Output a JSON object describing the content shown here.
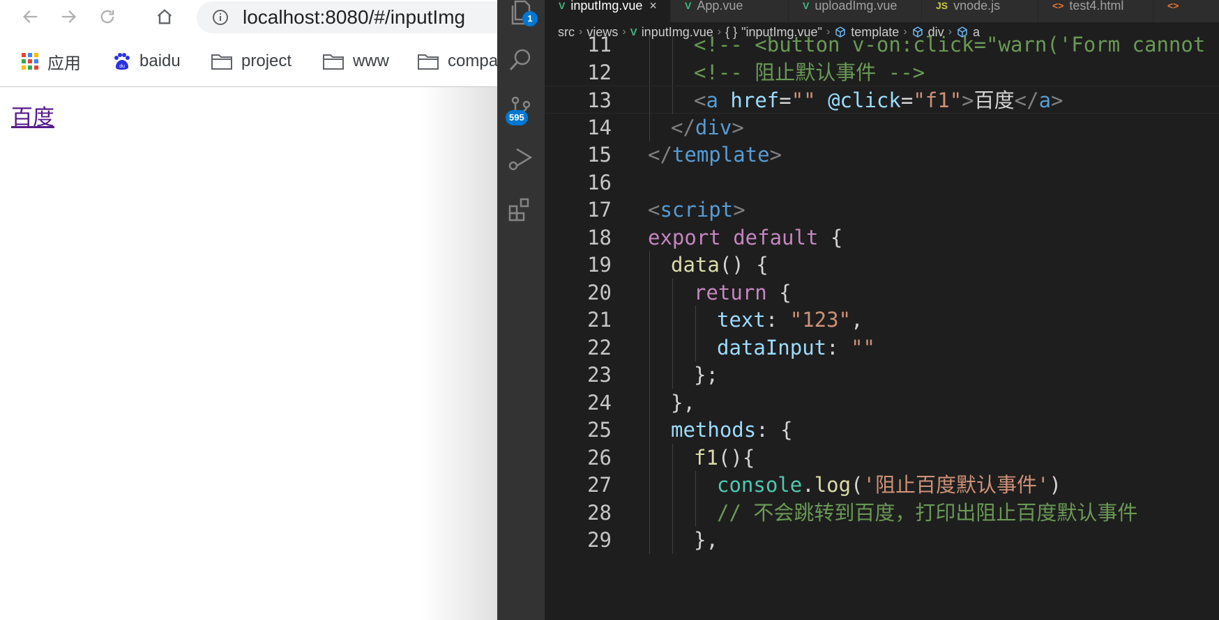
{
  "browser": {
    "url": "localhost:8080/#/inputImg",
    "bookmarks": [
      {
        "label": "应用",
        "icon": "apps-grid-icon"
      },
      {
        "label": "baidu",
        "icon": "baidu-paw-icon"
      },
      {
        "label": "project",
        "icon": "folder-icon"
      },
      {
        "label": "www",
        "icon": "folder-icon"
      },
      {
        "label": "compa",
        "icon": "folder-icon"
      }
    ],
    "page_link": "百度"
  },
  "editor": {
    "activity_badges": {
      "explorer": "1",
      "source_control": "595"
    },
    "tabs": [
      {
        "label": "inputImg.vue",
        "icon": "vue-icon",
        "close": "×"
      },
      {
        "label": "App.vue",
        "icon": "vue-icon"
      },
      {
        "label": "uploadImg.vue",
        "icon": "vue-icon"
      },
      {
        "label": "vnode.js",
        "icon": "js-icon",
        "icon_text": "JS"
      },
      {
        "label": "test4.html",
        "icon": "html-icon",
        "icon_text": "<>"
      },
      {
        "label": "",
        "icon": "html-icon",
        "icon_text": "<>"
      }
    ],
    "breadcrumb": [
      "src",
      "views",
      "inputImg.vue",
      "\"inputImg.vue\"",
      "template",
      "div",
      "a"
    ],
    "breadcrumb_symbols": [
      "",
      "",
      "",
      "{ }",
      "",
      "",
      ""
    ],
    "colors": {
      "comment": "#6a9955",
      "tag": "#569cd6",
      "keyword": "#c586c0",
      "string": "#ce9178",
      "function": "#dcdcaa",
      "property": "#9cdcfe",
      "badge": "#0078d4"
    },
    "lines": [
      {
        "n": "11",
        "indent": 2,
        "tokens": [
          {
            "t": "<!-- <button v-on:click=\"warn('Form cannot",
            "c": "comment"
          }
        ]
      },
      {
        "n": "12",
        "indent": 2,
        "tokens": [
          {
            "t": "<!-- 阻止默认事件 -->",
            "c": "comment"
          }
        ]
      },
      {
        "n": "13",
        "indent": 2,
        "tokens": [
          {
            "t": "<",
            "c": "punc"
          },
          {
            "t": "a",
            "c": "tag"
          },
          {
            "t": " ",
            "c": "plain"
          },
          {
            "t": "href",
            "c": "attr"
          },
          {
            "t": "=",
            "c": "plain"
          },
          {
            "t": "\"\"",
            "c": "str"
          },
          {
            "t": " @click",
            "c": "attr"
          },
          {
            "t": "=",
            "c": "plain"
          },
          {
            "t": "\"f1\"",
            "c": "str"
          },
          {
            "t": ">",
            "c": "punc"
          },
          {
            "t": "百度",
            "c": "plain"
          },
          {
            "t": "</",
            "c": "punc"
          },
          {
            "t": "a",
            "c": "tag"
          },
          {
            "t": ">",
            "c": "punc"
          }
        ]
      },
      {
        "n": "14",
        "indent": 1,
        "tokens": [
          {
            "t": "</",
            "c": "punc"
          },
          {
            "t": "div",
            "c": "tag"
          },
          {
            "t": ">",
            "c": "punc"
          }
        ]
      },
      {
        "n": "15",
        "indent": 0,
        "tokens": [
          {
            "t": "</",
            "c": "punc"
          },
          {
            "t": "template",
            "c": "tag"
          },
          {
            "t": ">",
            "c": "punc"
          }
        ]
      },
      {
        "n": "16",
        "indent": 0,
        "tokens": []
      },
      {
        "n": "17",
        "indent": 0,
        "tokens": [
          {
            "t": "<",
            "c": "punc"
          },
          {
            "t": "script",
            "c": "tag"
          },
          {
            "t": ">",
            "c": "punc"
          }
        ]
      },
      {
        "n": "18",
        "indent": 0,
        "tokens": [
          {
            "t": "export default",
            "c": "kw"
          },
          {
            "t": " {",
            "c": "plain"
          }
        ]
      },
      {
        "n": "19",
        "indent": 1,
        "tokens": [
          {
            "t": "data",
            "c": "fn"
          },
          {
            "t": "() {",
            "c": "plain"
          }
        ]
      },
      {
        "n": "20",
        "indent": 2,
        "tokens": [
          {
            "t": "return",
            "c": "kw"
          },
          {
            "t": " {",
            "c": "plain"
          }
        ]
      },
      {
        "n": "21",
        "indent": 3,
        "tokens": [
          {
            "t": "text",
            "c": "prop"
          },
          {
            "t": ": ",
            "c": "plain"
          },
          {
            "t": "\"123\"",
            "c": "str"
          },
          {
            "t": ",",
            "c": "plain"
          }
        ]
      },
      {
        "n": "22",
        "indent": 3,
        "tokens": [
          {
            "t": "dataInput",
            "c": "prop"
          },
          {
            "t": ": ",
            "c": "plain"
          },
          {
            "t": "\"\"",
            "c": "str"
          }
        ]
      },
      {
        "n": "23",
        "indent": 2,
        "tokens": [
          {
            "t": "};",
            "c": "plain"
          }
        ]
      },
      {
        "n": "24",
        "indent": 1,
        "tokens": [
          {
            "t": "},",
            "c": "plain"
          }
        ]
      },
      {
        "n": "25",
        "indent": 1,
        "tokens": [
          {
            "t": "methods",
            "c": "prop"
          },
          {
            "t": ": {",
            "c": "plain"
          }
        ]
      },
      {
        "n": "26",
        "indent": 2,
        "tokens": [
          {
            "t": "f1",
            "c": "fn"
          },
          {
            "t": "(){",
            "c": "plain"
          }
        ]
      },
      {
        "n": "27",
        "indent": 3,
        "tokens": [
          {
            "t": "console",
            "c": "obj"
          },
          {
            "t": ".",
            "c": "plain"
          },
          {
            "t": "log",
            "c": "fn"
          },
          {
            "t": "(",
            "c": "plain"
          },
          {
            "t": "'阻止百度默认事件'",
            "c": "str"
          },
          {
            "t": ")",
            "c": "plain"
          }
        ]
      },
      {
        "n": "28",
        "indent": 3,
        "tokens": [
          {
            "t": "// 不会跳转到百度，打印出阻止百度默认事件",
            "c": "comment"
          }
        ]
      },
      {
        "n": "29",
        "indent": 2,
        "tokens": [
          {
            "t": "},",
            "c": "plain"
          }
        ]
      }
    ]
  }
}
